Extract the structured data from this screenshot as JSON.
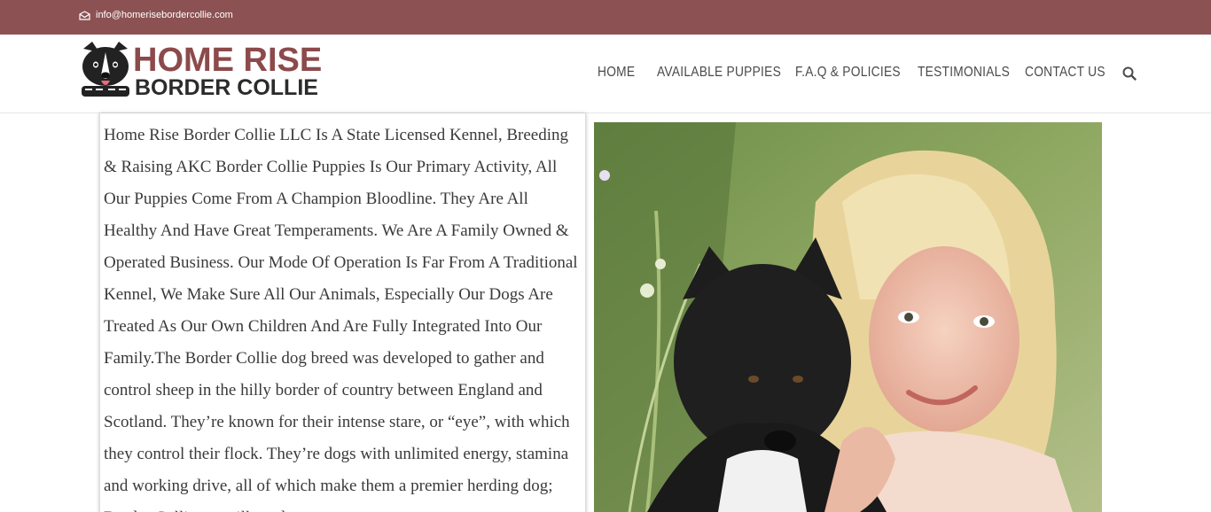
{
  "topbar": {
    "email": "info@homerisebordercollie.com",
    "bg_color": "#8c5253",
    "icon": "mail-icon"
  },
  "logo": {
    "line1": "HOME RISE",
    "line2": "BORDER COLLIE",
    "icon": "border-collie-dog-logo",
    "line1_color": "#8c4a4b"
  },
  "nav": {
    "items": [
      "HOME",
      "AVAILABLE PUPPIES",
      "F.A.Q & POLICIES",
      "TESTIMONIALS",
      "CONTACT US"
    ],
    "search_icon": "search-icon"
  },
  "content": {
    "body": "Home Rise Border Collie LLC Is A State Licensed Kennel, Breeding & Raising AKC Border Collie Puppies Is Our Primary Activity, All Our Puppies Come From A Champion Bloodline. They Are All Healthy And Have Great Temperaments. We Are A Family Owned & Operated Business. Our Mode Of Operation Is Far From A Traditional Kennel, We Make Sure All Our Animals, Especially Our Dogs Are Treated As Our Own Children And Are Fully Integrated Into Our Family.The Border Collie dog breed was developed to gather and control sheep in the hilly border of country between England and Scotland. They’re known for their intense stare, or “eye”, with which they control their flock. They’re dogs with unlimited energy, stamina and working drive, all of which make them a premier herding dog; Border Collie are still used"
  }
}
